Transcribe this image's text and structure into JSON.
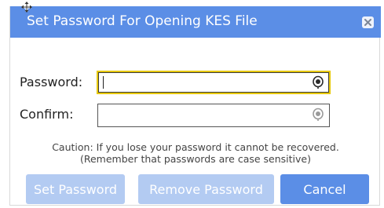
{
  "dialog": {
    "title": "Set Password For Opening KES File",
    "close_icon": "close-icon",
    "move_icon": "move-cursor-icon"
  },
  "form": {
    "password_label": "Password:",
    "password_value": "",
    "confirm_label": "Confirm:",
    "confirm_value": "",
    "visibility_icon": "eye-icon"
  },
  "caution": {
    "line1": "Caution: If you lose your password it cannot be recovered.",
    "line2": "(Remember that passwords are case sensitive)"
  },
  "buttons": {
    "set_password": "Set Password",
    "remove_password": "Remove Password",
    "cancel": "Cancel"
  },
  "colors": {
    "titlebar": "#5b8ee6",
    "button_primary": "#5b8ee6",
    "button_disabled": "#b3cbf2",
    "focus_border": "#e7c800"
  }
}
